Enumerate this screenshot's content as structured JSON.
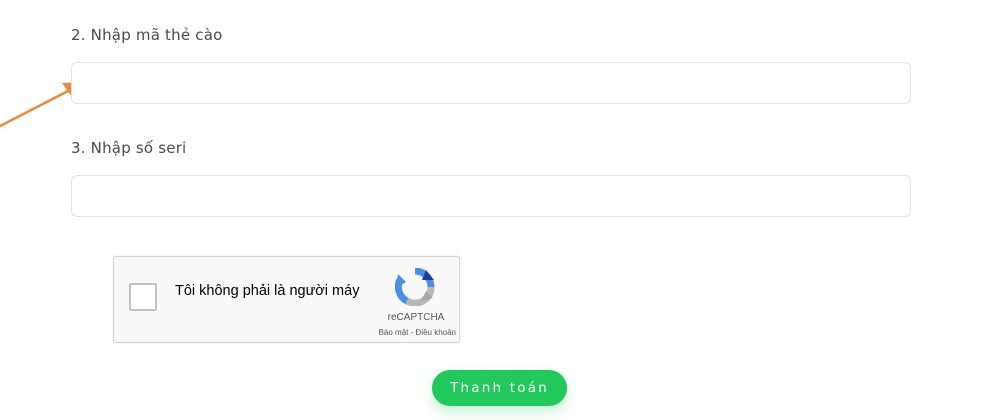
{
  "form": {
    "card_code": {
      "label": "2. Nhập mã thẻ cào",
      "value": "",
      "placeholder": ""
    },
    "serial": {
      "label": "3. Nhập số seri",
      "value": "",
      "placeholder": ""
    },
    "submit_label": "Thanh toán"
  },
  "recaptcha": {
    "checkbox_text": "Tôi không phải là người máy",
    "brand": "reCAPTCHA",
    "privacy_link": "Bảo mật",
    "separator": "-",
    "terms_link": "Điều khoản",
    "checked": false
  },
  "annotation": {
    "arrow_color": "#f0883a"
  },
  "colors": {
    "accent": "#21c95c",
    "label_text": "#4a4a4a",
    "input_border": "#e3e3e3"
  }
}
